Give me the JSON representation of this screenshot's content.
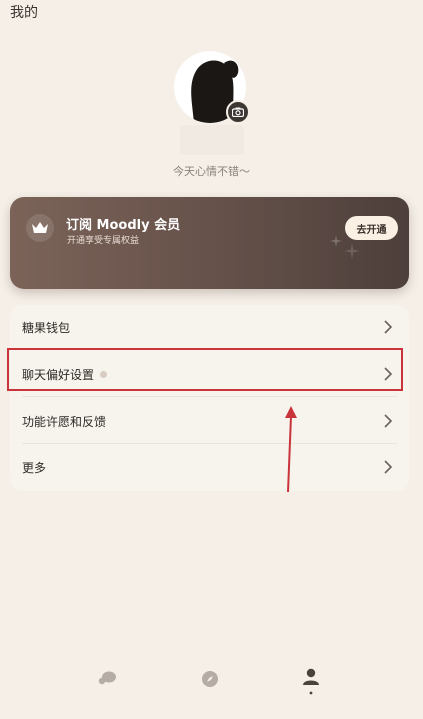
{
  "header": {
    "title": "我的"
  },
  "profile": {
    "avatar_icon": "girl-silhouette-avatar",
    "camera_icon": "camera-icon",
    "mood": "今天心情不错～"
  },
  "vip": {
    "icon": "crown-icon",
    "title": "订阅 Moodly 会员",
    "subtitle": "开通享受专属权益",
    "button": "去开通"
  },
  "menu": {
    "items": [
      {
        "label": "糖果钱包"
      },
      {
        "label": "聊天偏好设置"
      },
      {
        "label": "功能许愿和反馈"
      },
      {
        "label": "更多"
      }
    ]
  },
  "tabbar": {
    "tabs": [
      {
        "icon": "chat-bubbles-icon"
      },
      {
        "icon": "compass-icon"
      },
      {
        "icon": "person-icon",
        "active": true
      }
    ]
  },
  "colors": {
    "background": "#f5efe7",
    "card": "#f7f3ed",
    "vip_gradient_start": "#7b6358",
    "vip_gradient_end": "#4d3f3b",
    "highlight": "#c9343b"
  }
}
